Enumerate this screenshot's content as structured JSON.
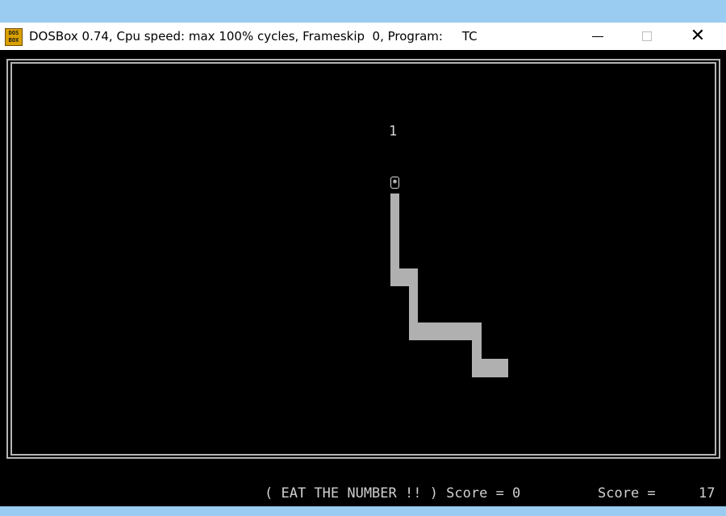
{
  "window": {
    "title": "DOSBox 0.74, Cpu speed: max 100% cycles, Frameskip  0, Program:     TC",
    "icon": "dosbox-icon",
    "icon_text": "DOS BOX",
    "controls": {
      "minimize_icon": "minimize-icon",
      "maximize_icon": "maximize-icon",
      "close_icon": "close-icon",
      "close_glyph": "✕"
    }
  },
  "game": {
    "food_number": "1",
    "snake_head_glyph": "☻",
    "colors": {
      "background": "#000000",
      "snake_body": "#b0b0b0",
      "border": "#b5b5b5",
      "text": "#d0d0d0"
    }
  },
  "status_bar": {
    "message": "( EAT THE NUMBER !! ) Score = 0",
    "score_label": "Score =",
    "score_value": "17"
  }
}
